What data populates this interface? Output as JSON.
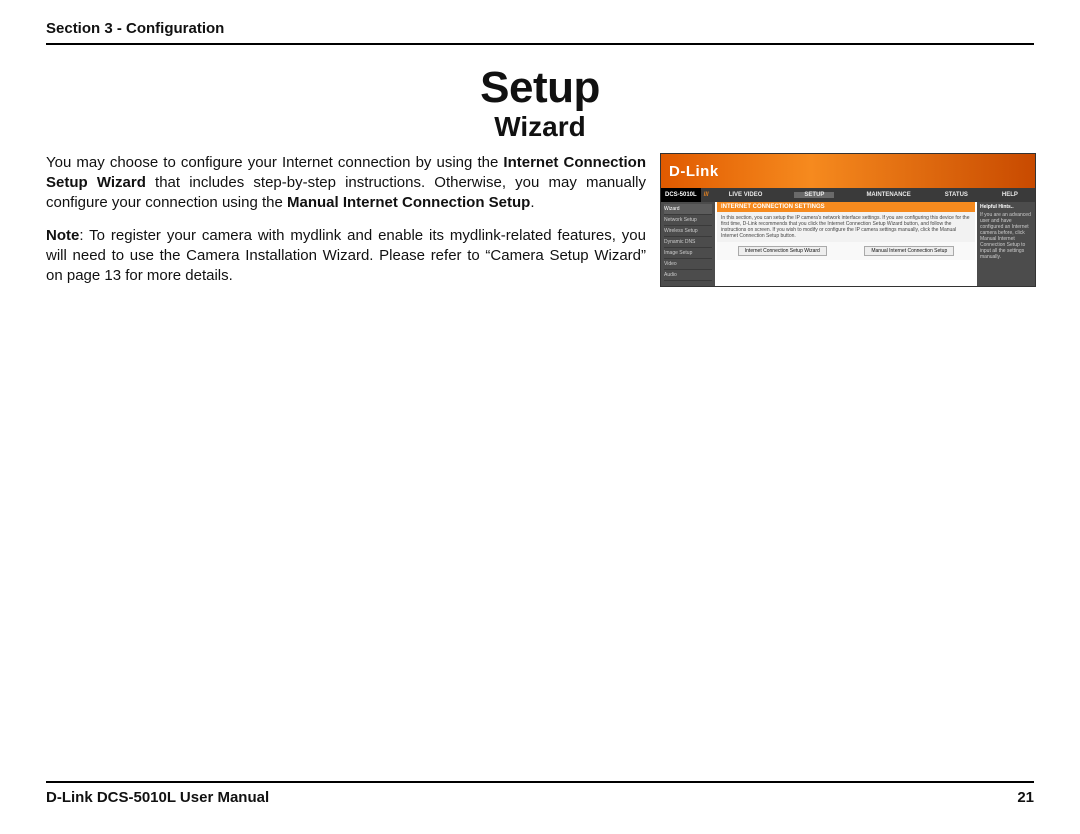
{
  "header": {
    "section": "Section 3 - Configuration"
  },
  "titles": {
    "main": "Setup",
    "sub": "Wizard"
  },
  "body": {
    "p1_pre": "You may choose to configure your Internet connection by using the ",
    "p1_b1": "Internet Connection Setup Wizard",
    "p1_mid": " that includes step-by-step instructions. Otherwise, you may manually configure your connection using the ",
    "p1_b2": "Manual Internet Connection Setup",
    "p1_post": ".",
    "p2_b": "Note",
    "p2_rest": ": To register your camera with mydlink and enable its mydlink-related features, you will need to use the Camera Installation Wizard. Please refer to “Camera Setup Wizard” on page 13 for more details."
  },
  "screenshot": {
    "brand": "D-Link",
    "model": "DCS-5010L",
    "tabs": [
      "LIVE VIDEO",
      "SETUP",
      "MAINTENANCE",
      "STATUS",
      "HELP"
    ],
    "active_tab": "SETUP",
    "side": [
      "Wizard",
      "Network Setup",
      "Wireless Setup",
      "Dynamic DNS",
      "Image Setup",
      "Video",
      "Audio"
    ],
    "side_selected": "Wizard",
    "panel_title": "INTERNET CONNECTION SETTINGS",
    "panel_text": "In this section, you can setup the IP camera's network interface settings. If you are configuring this device for the first time, D-Link recommends that you click the Internet Connection Setup Wizard button, and follow the instructions on screen. If you wish to modify or configure the IP camera settings manually, click the Manual Internet Connection Setup button.",
    "buttons": [
      "Internet Connection Setup Wizard",
      "Manual Internet Connection Setup"
    ],
    "hints_title": "Helpful Hints..",
    "hints_text": "If you are an advanced user and have configured an Internet camera before, click Manual Internet Connection Setup to input all the settings manually."
  },
  "footer": {
    "left": "D-Link DCS-5010L User Manual",
    "right": "21"
  }
}
